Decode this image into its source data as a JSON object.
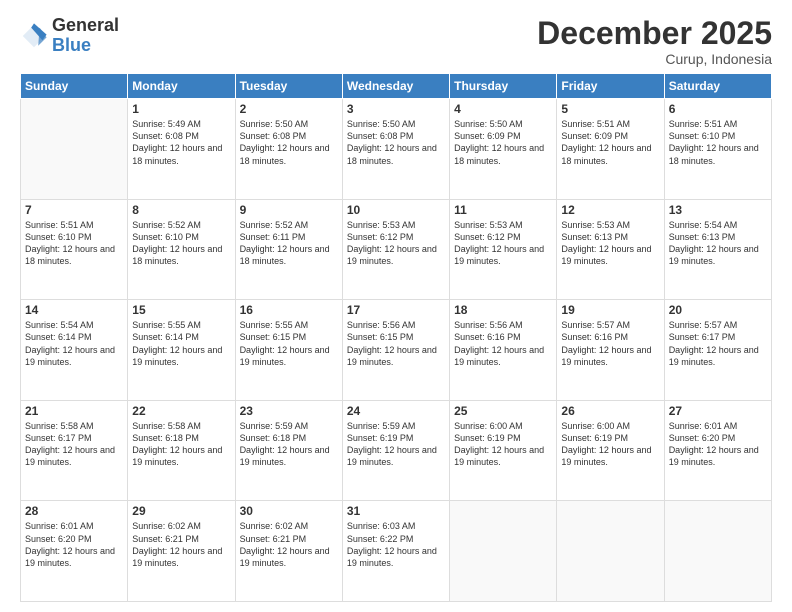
{
  "logo": {
    "general": "General",
    "blue": "Blue"
  },
  "title": "December 2025",
  "subtitle": "Curup, Indonesia",
  "days_of_week": [
    "Sunday",
    "Monday",
    "Tuesday",
    "Wednesday",
    "Thursday",
    "Friday",
    "Saturday"
  ],
  "weeks": [
    [
      {
        "day": "",
        "info": ""
      },
      {
        "day": "1",
        "info": "Sunrise: 5:49 AM\nSunset: 6:08 PM\nDaylight: 12 hours and 18 minutes."
      },
      {
        "day": "2",
        "info": "Sunrise: 5:50 AM\nSunset: 6:08 PM\nDaylight: 12 hours and 18 minutes."
      },
      {
        "day": "3",
        "info": "Sunrise: 5:50 AM\nSunset: 6:08 PM\nDaylight: 12 hours and 18 minutes."
      },
      {
        "day": "4",
        "info": "Sunrise: 5:50 AM\nSunset: 6:09 PM\nDaylight: 12 hours and 18 minutes."
      },
      {
        "day": "5",
        "info": "Sunrise: 5:51 AM\nSunset: 6:09 PM\nDaylight: 12 hours and 18 minutes."
      },
      {
        "day": "6",
        "info": "Sunrise: 5:51 AM\nSunset: 6:10 PM\nDaylight: 12 hours and 18 minutes."
      }
    ],
    [
      {
        "day": "7",
        "info": ""
      },
      {
        "day": "8",
        "info": "Sunrise: 5:52 AM\nSunset: 6:10 PM\nDaylight: 12 hours and 18 minutes."
      },
      {
        "day": "9",
        "info": "Sunrise: 5:52 AM\nSunset: 6:11 PM\nDaylight: 12 hours and 18 minutes."
      },
      {
        "day": "10",
        "info": "Sunrise: 5:53 AM\nSunset: 6:12 PM\nDaylight: 12 hours and 19 minutes."
      },
      {
        "day": "11",
        "info": "Sunrise: 5:53 AM\nSunset: 6:12 PM\nDaylight: 12 hours and 19 minutes."
      },
      {
        "day": "12",
        "info": "Sunrise: 5:53 AM\nSunset: 6:13 PM\nDaylight: 12 hours and 19 minutes."
      },
      {
        "day": "13",
        "info": "Sunrise: 5:54 AM\nSunset: 6:13 PM\nDaylight: 12 hours and 19 minutes."
      }
    ],
    [
      {
        "day": "14",
        "info": ""
      },
      {
        "day": "15",
        "info": "Sunrise: 5:55 AM\nSunset: 6:14 PM\nDaylight: 12 hours and 19 minutes."
      },
      {
        "day": "16",
        "info": "Sunrise: 5:55 AM\nSunset: 6:15 PM\nDaylight: 12 hours and 19 minutes."
      },
      {
        "day": "17",
        "info": "Sunrise: 5:56 AM\nSunset: 6:15 PM\nDaylight: 12 hours and 19 minutes."
      },
      {
        "day": "18",
        "info": "Sunrise: 5:56 AM\nSunset: 6:16 PM\nDaylight: 12 hours and 19 minutes."
      },
      {
        "day": "19",
        "info": "Sunrise: 5:57 AM\nSunset: 6:16 PM\nDaylight: 12 hours and 19 minutes."
      },
      {
        "day": "20",
        "info": "Sunrise: 5:57 AM\nSunset: 6:17 PM\nDaylight: 12 hours and 19 minutes."
      }
    ],
    [
      {
        "day": "21",
        "info": ""
      },
      {
        "day": "22",
        "info": "Sunrise: 5:58 AM\nSunset: 6:18 PM\nDaylight: 12 hours and 19 minutes."
      },
      {
        "day": "23",
        "info": "Sunrise: 5:59 AM\nSunset: 6:18 PM\nDaylight: 12 hours and 19 minutes."
      },
      {
        "day": "24",
        "info": "Sunrise: 5:59 AM\nSunset: 6:19 PM\nDaylight: 12 hours and 19 minutes."
      },
      {
        "day": "25",
        "info": "Sunrise: 6:00 AM\nSunset: 6:19 PM\nDaylight: 12 hours and 19 minutes."
      },
      {
        "day": "26",
        "info": "Sunrise: 6:00 AM\nSunset: 6:19 PM\nDaylight: 12 hours and 19 minutes."
      },
      {
        "day": "27",
        "info": "Sunrise: 6:01 AM\nSunset: 6:20 PM\nDaylight: 12 hours and 19 minutes."
      }
    ],
    [
      {
        "day": "28",
        "info": "Sunrise: 6:01 AM\nSunset: 6:20 PM\nDaylight: 12 hours and 19 minutes."
      },
      {
        "day": "29",
        "info": "Sunrise: 6:02 AM\nSunset: 6:21 PM\nDaylight: 12 hours and 19 minutes."
      },
      {
        "day": "30",
        "info": "Sunrise: 6:02 AM\nSunset: 6:21 PM\nDaylight: 12 hours and 19 minutes."
      },
      {
        "day": "31",
        "info": "Sunrise: 6:03 AM\nSunset: 6:22 PM\nDaylight: 12 hours and 19 minutes."
      },
      {
        "day": "",
        "info": ""
      },
      {
        "day": "",
        "info": ""
      },
      {
        "day": "",
        "info": ""
      }
    ]
  ],
  "week1_day7_info": "Sunrise: 5:51 AM\nSunset: 6:10 PM\nDaylight: 12 hours and 18 minutes.",
  "week2_day14_info": "Sunrise: 5:54 AM\nSunset: 6:14 PM\nDaylight: 12 hours and 19 minutes.",
  "week3_day21_info": "Sunrise: 5:58 AM\nSunset: 6:17 PM\nDaylight: 12 hours and 19 minutes."
}
